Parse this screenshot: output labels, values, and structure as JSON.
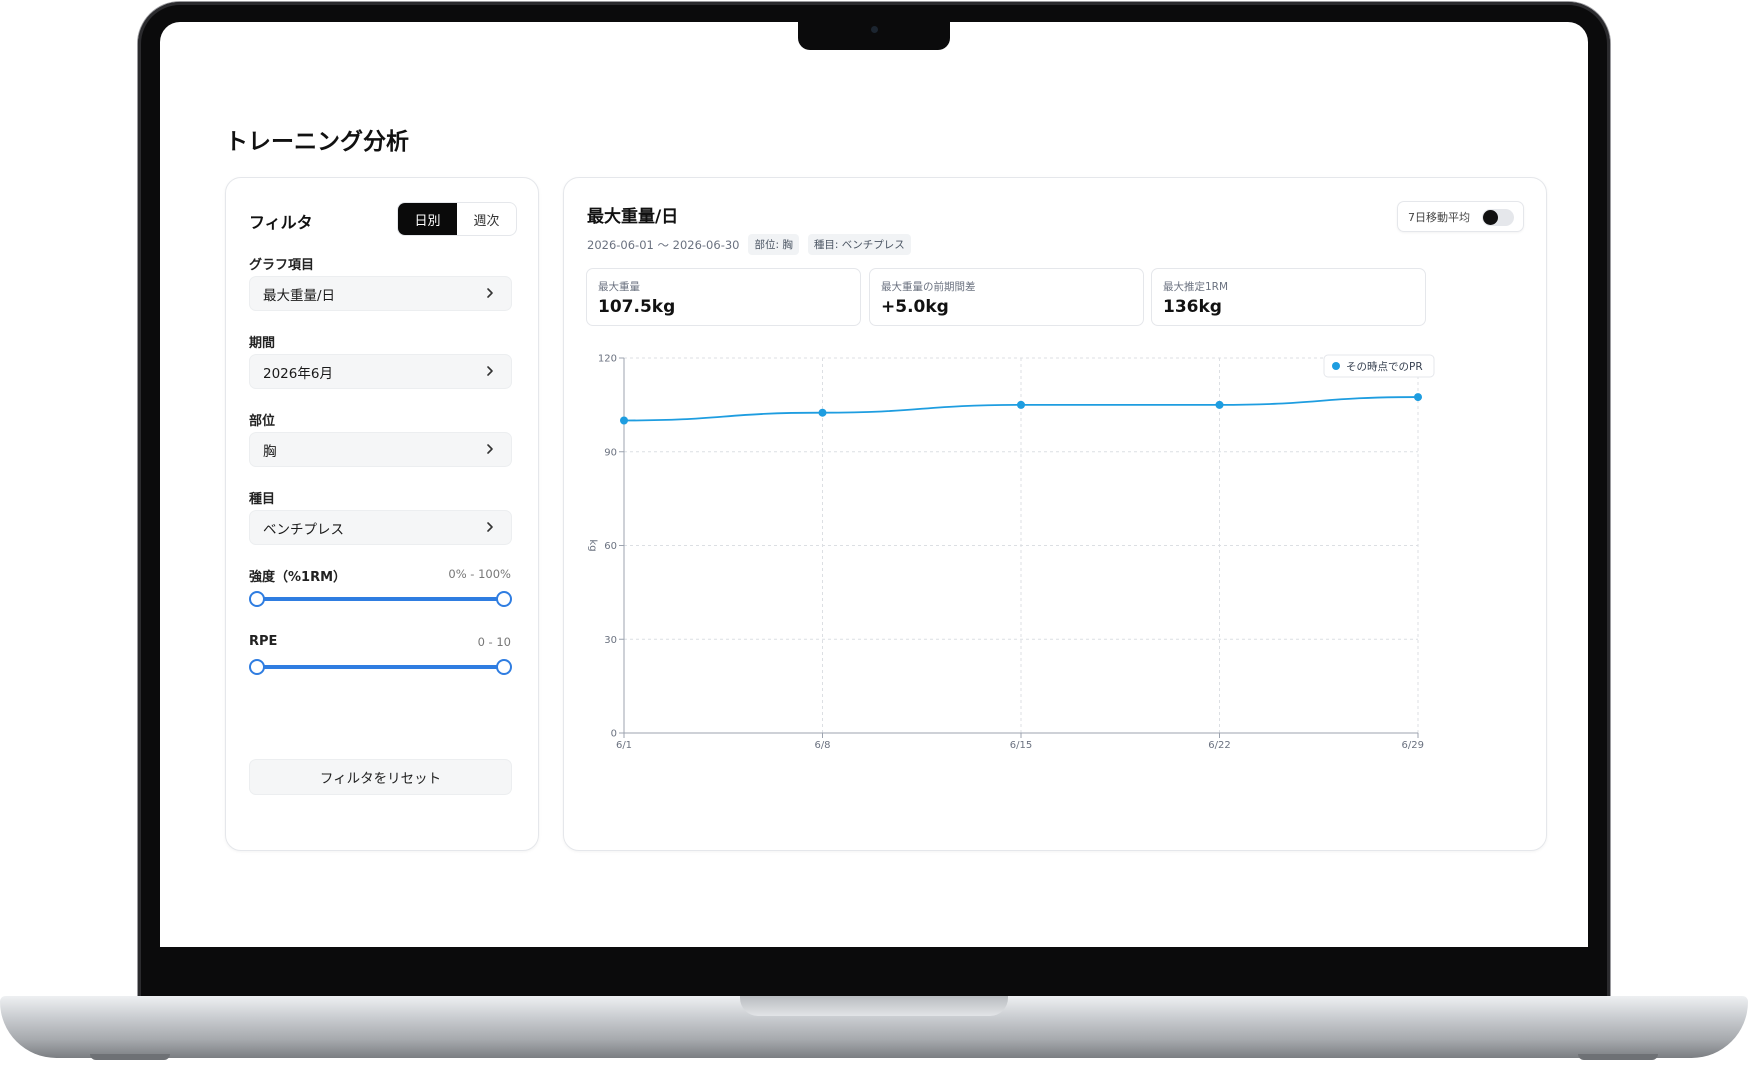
{
  "page_title": "トレーニング分析",
  "filter": {
    "title": "フィルタ",
    "view_modes": [
      "日別",
      "週次"
    ],
    "active_mode": "日別",
    "fields": [
      {
        "label": "グラフ項目",
        "value": "最大重量/日"
      },
      {
        "label": "期間",
        "value": "2026年6月"
      },
      {
        "label": "部位",
        "value": "胸"
      },
      {
        "label": "種目",
        "value": "ベンチプレス"
      }
    ],
    "ranges": [
      {
        "label": "強度（%1RM）",
        "value": "0% - 100%"
      },
      {
        "label": "RPE",
        "value": "0 - 10"
      }
    ],
    "reset_label": "フィルタをリセット"
  },
  "chart": {
    "title": "最大重量/日",
    "date_range": "2026-06-01 〜 2026-06-30",
    "tags": [
      "部位: 胸",
      "種目: ベンチプレス"
    ],
    "moving_average_label": "7日移動平均",
    "moving_average_on": false,
    "stats": [
      {
        "label": "最大重量",
        "value": "107.5kg"
      },
      {
        "label": "最大重量の前期間差",
        "value": "+5.0kg"
      },
      {
        "label": "最大推定1RM",
        "value": "136kg"
      }
    ]
  },
  "colors": {
    "accent": "#2f7de1",
    "series": "#1e9de0",
    "toggle_active": "#0a0a0a"
  },
  "icons": [
    "chevron-right-icon"
  ],
  "chart_data": {
    "type": "line",
    "x": [
      "6/1",
      "6/8",
      "6/15",
      "6/22",
      "6/29"
    ],
    "series": [
      {
        "name": "その時点でのPR",
        "values": [
          100,
          102.5,
          105,
          105,
          107.5
        ]
      }
    ],
    "ylabel": "kg",
    "yticks": [
      0,
      30,
      60,
      90,
      120
    ],
    "ylim": [
      0,
      120
    ],
    "grid": true,
    "legend": "top-right"
  }
}
